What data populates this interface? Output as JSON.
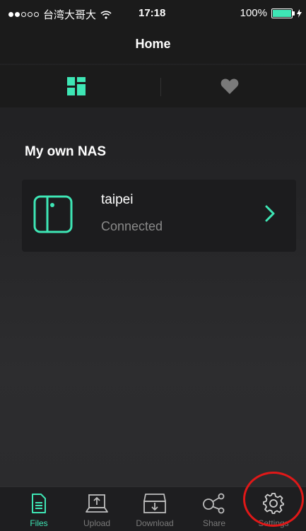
{
  "status_bar": {
    "carrier": "台湾大哥大",
    "time": "17:18",
    "battery_percent": "100%"
  },
  "nav": {
    "title": "Home"
  },
  "tabs": [
    {
      "icon": "grid-icon",
      "active": true
    },
    {
      "icon": "heart-icon",
      "active": false
    }
  ],
  "section": {
    "title": "My own NAS"
  },
  "nas": {
    "name": "taipei",
    "status": "Connected"
  },
  "bottom_tabs": [
    {
      "label": "Files",
      "icon": "file-icon",
      "active": true
    },
    {
      "label": "Upload",
      "icon": "upload-icon",
      "active": false
    },
    {
      "label": "Download",
      "icon": "download-icon",
      "active": false
    },
    {
      "label": "Share",
      "icon": "share-icon",
      "active": false
    },
    {
      "label": "Settings",
      "icon": "gear-icon",
      "active": false
    }
  ],
  "colors": {
    "accent": "#3ee6b5",
    "highlight": "#e01818"
  }
}
